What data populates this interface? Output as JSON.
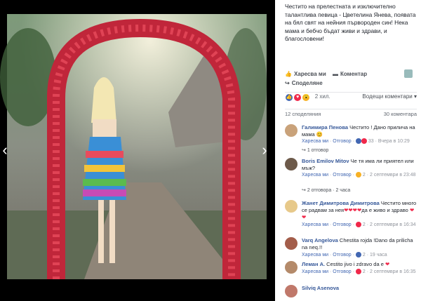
{
  "caption": "Честито на прелестната и изключително талантлива певица - Цветелина Янева, появата на бял свят на нейния първороден син! Нека мама и бебчо бъдат живи и здрави, и благословени!",
  "actions": {
    "like": "Харесва ми",
    "comment": "Коментар",
    "share": "Споделяне"
  },
  "reactions": {
    "count": "2 хил.",
    "sort_label": "Водещи коментари"
  },
  "stats": {
    "shares": "12 споделяния",
    "comments": "30 коментара"
  },
  "colors": {
    "link": "#365899",
    "meta": "#90949c",
    "heart": "#f0284a",
    "like_blue": "#4267b2"
  },
  "comments": [
    {
      "name": "Галимира Пенова",
      "text": "Честито ! Дано прилича на мама 😊",
      "like": "Харесва ми",
      "reply": "Отговор",
      "count": "33",
      "time": "Вчера в 10:29",
      "replies": "1 отговор"
    },
    {
      "name": "Boris Emilov Mitov",
      "text": "Че тя има ли приятел или мъж?",
      "like": "Харесва ми",
      "reply": "Отговор",
      "count": "2",
      "time": "2 септември в 23:48",
      "replies": "2 отговора",
      "replies_time": "2 часа"
    },
    {
      "name": "Жанет Димитрова Димитрова",
      "text": "Честито много се радвам за нея",
      "text2": "да е живо и здраво",
      "like": "Харесва ми",
      "reply": "Отговор",
      "count": "2",
      "time": "2 септември в 16:34"
    },
    {
      "name": "Varq Angelova",
      "text": "Chestita rojda !Dano da prilicha na neq.!!",
      "like": "Харесва ми",
      "reply": "Отговор",
      "count": "2",
      "time": "19 часа"
    },
    {
      "name": "Леман А.",
      "text": "Cestito jivo i zdravo da e",
      "like": "Харесва ми",
      "reply": "Отговор",
      "count": "2",
      "time": "2 септември в 16:35"
    },
    {
      "name": "Silviq Asenova",
      "text": ""
    }
  ]
}
